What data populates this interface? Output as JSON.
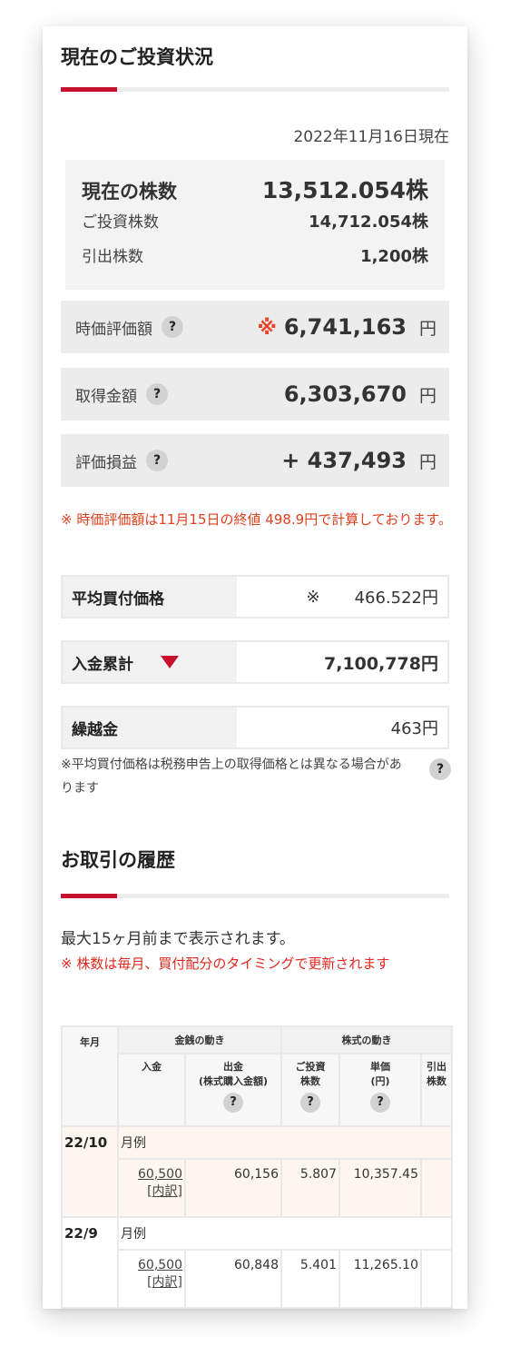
{
  "investment": {
    "title": "現在のご投資状況",
    "date": "2022年11月16日現在",
    "shares": {
      "current_label": "現在の株数",
      "current_value": "13,512.054株",
      "invested_label": "ご投資株数",
      "invested_value": "14,712.054株",
      "withdrawn_label": "引出株数",
      "withdrawn_value": "1,200株"
    },
    "rows": [
      {
        "label": "時価評価額",
        "mark": "※",
        "value": "6,741,163",
        "unit": "円"
      },
      {
        "label": "取得金額",
        "value": "6,303,670",
        "unit": "円"
      },
      {
        "label": "評価損益",
        "value": "+ 437,493",
        "unit": "円"
      }
    ],
    "help_icon": "?",
    "note": "※ 時価評価額は11月15日の終値 498.9円で計算しております。",
    "avg_label": "平均買付価格",
    "avg_mark": "※",
    "avg_value": "466.522円",
    "deposit_label": "入金累計",
    "deposit_value": "7,100,778円",
    "carry_label": "繰越金",
    "carry_value": "463円",
    "avg_note": "※平均買付価格は税務申告上の取得価格とは異なる場合があります"
  },
  "history": {
    "title": "お取引の履歴",
    "note1": "最大15ヶ月前まで表示されます。",
    "note2": "※ 株数は毎月、買付配分のタイミングで更新されます",
    "table": {
      "h_month": "年月",
      "h_money": "金銭の動き",
      "h_stock": "株式の動き",
      "h_deposit": "入金",
      "h_withdraw": "出金",
      "h_withdraw_sub": "(株式購入金額)",
      "h_shares": "ご投資",
      "h_shares_sub": "株数",
      "h_price": "単価",
      "h_price_sub": "(円)",
      "h_pull": "引出",
      "h_pull_sub": "株数",
      "rows": [
        {
          "month": "22/10",
          "kind": "月例",
          "deposit": "60,500",
          "detail": "[内訳]",
          "withdraw": "60,156",
          "shares": "5.807",
          "price": "10,357.45"
        },
        {
          "month": "22/9",
          "kind": "月例",
          "deposit": "60,500",
          "detail": "[内訳]",
          "withdraw": "60,848",
          "shares": "5.401",
          "price": "11,265.10"
        }
      ]
    }
  },
  "colors": {
    "accent": "#c8102e",
    "note_red": "#e0401e",
    "highlight_row": "#fdf6ee"
  },
  "icons": [
    "help-icon",
    "triangle-down-icon"
  ]
}
